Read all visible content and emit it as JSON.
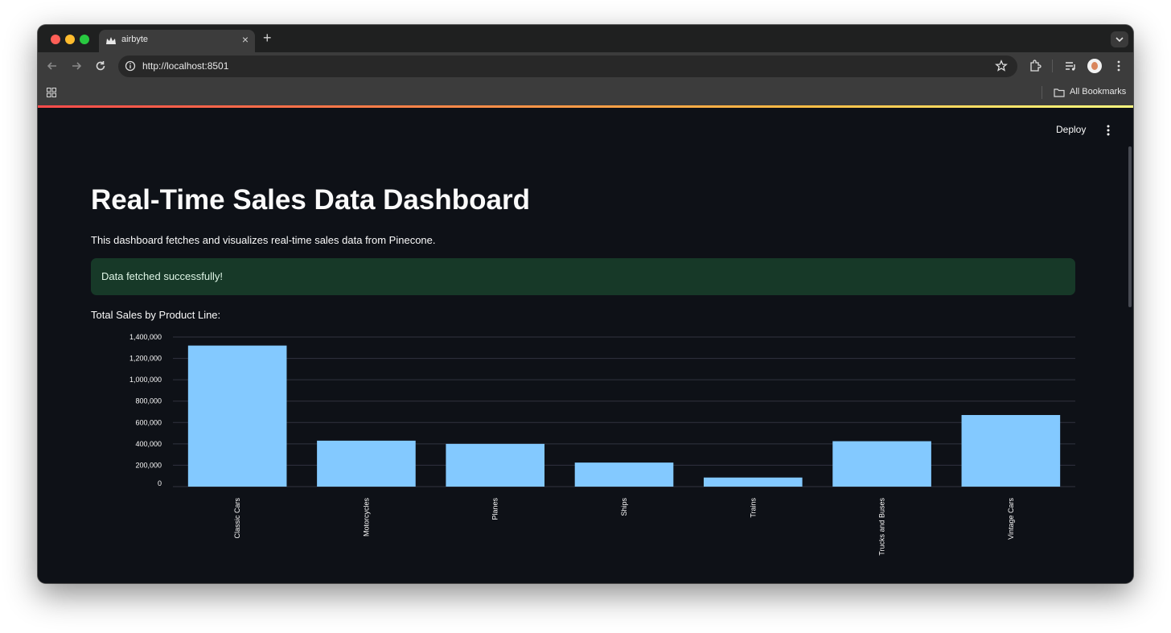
{
  "browser": {
    "tab_title": "airbyte",
    "url": "http://localhost:8501",
    "bookmarks_label": "All Bookmarks"
  },
  "app": {
    "deploy_label": "Deploy",
    "title": "Real-Time Sales Data Dashboard",
    "subtitle": "This dashboard fetches and visualizes real-time sales data from Pinecone.",
    "alert": "Data fetched successfully!",
    "chart_heading": "Total Sales by Product Line:"
  },
  "colors": {
    "bar": "#83c9ff",
    "background": "#0e1117",
    "success_bg": "#173928"
  },
  "chart_data": {
    "type": "bar",
    "categories": [
      "Classic Cars",
      "Motorcycles",
      "Planes",
      "Ships",
      "Trains",
      "Trucks and Buses",
      "Vintage Cars"
    ],
    "values": [
      1320000,
      430000,
      400000,
      225000,
      85000,
      425000,
      670000
    ],
    "ylim": [
      0,
      1400000
    ],
    "yticks": [
      0,
      200000,
      400000,
      600000,
      800000,
      1000000,
      1200000,
      1400000
    ],
    "ytick_labels": [
      "0",
      "200,000",
      "400,000",
      "600,000",
      "800,000",
      "1,000,000",
      "1,200,000",
      "1,400,000"
    ],
    "grid": true
  }
}
